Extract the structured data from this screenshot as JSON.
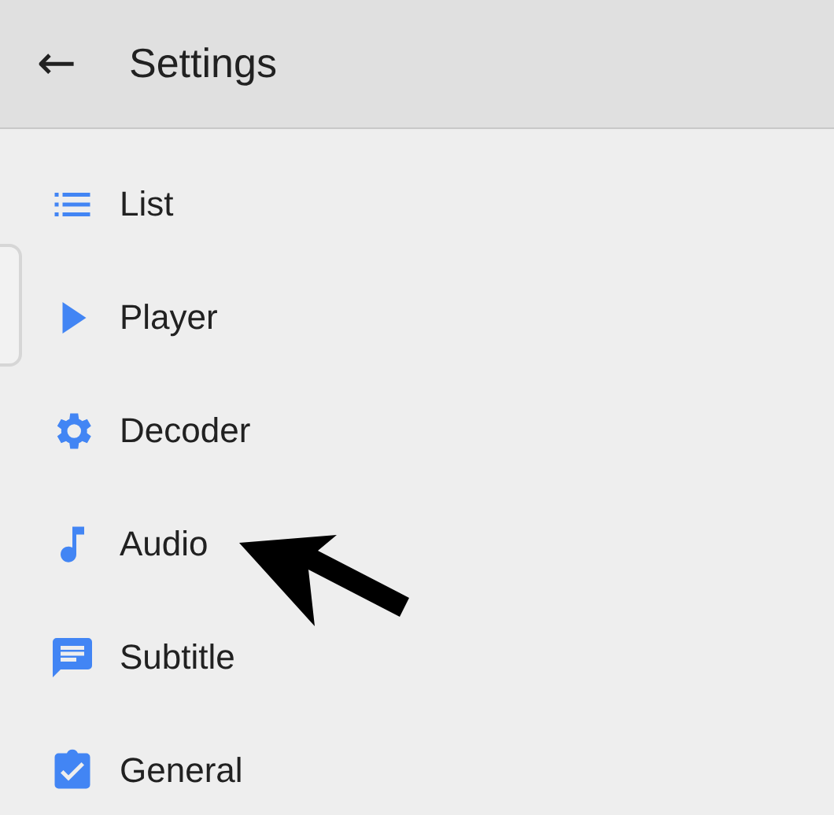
{
  "toolbar": {
    "back_icon": "←",
    "title": "Settings"
  },
  "items": [
    {
      "label": "List",
      "kind": "list"
    },
    {
      "label": "Player",
      "kind": "play"
    },
    {
      "label": "Decoder",
      "kind": "gear"
    },
    {
      "label": "Audio",
      "kind": "note"
    },
    {
      "label": "Subtitle",
      "kind": "subtitle"
    },
    {
      "label": "General",
      "kind": "clipboard"
    }
  ]
}
